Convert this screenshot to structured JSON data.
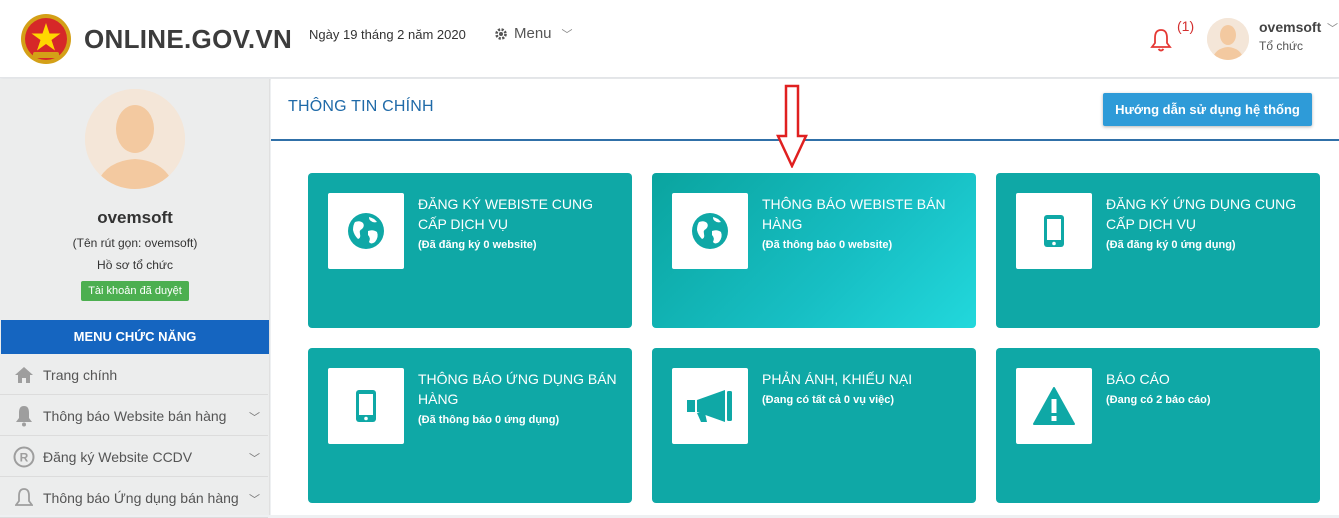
{
  "header": {
    "site_title": "ONLINE.GOV.VN",
    "date": "Ngày 19 tháng 2 năm 2020",
    "menu_label": "Menu",
    "notification_count": "(1)",
    "user_name": "ovemsoft",
    "user_role": "Tổ chức"
  },
  "sidebar": {
    "name": "ovemsoft",
    "short_name": "(Tên rút gọn: ovemsoft)",
    "profile_label": "Hồ sơ tổ chức",
    "account_badge": "Tài khoản đã duyệt",
    "menu_header": "MENU CHỨC NĂNG",
    "items": [
      {
        "label": "Trang chính",
        "icon": "home-icon"
      },
      {
        "label": "Thông báo Website bán hàng",
        "icon": "bell-icon"
      },
      {
        "label": "Đăng ký Website CCDV",
        "icon": "registered-icon"
      },
      {
        "label": "Thông báo Ứng dụng bán hàng",
        "icon": "bell-outline-icon"
      }
    ]
  },
  "main": {
    "title": "THÔNG TIN CHÍNH",
    "guide_button": "Hướng dẫn sử dụng hệ thống",
    "tiles": [
      {
        "title": "ĐĂNG KÝ WEBISTE CUNG CẤP DỊCH VỤ",
        "subtitle": "(Đã đăng ký 0 website)",
        "icon": "globe-icon"
      },
      {
        "title": "THÔNG BÁO WEBISTE BÁN HÀNG",
        "subtitle": "(Đã thông báo 0 website)",
        "icon": "globe-icon"
      },
      {
        "title": "ĐĂNG KÝ ỨNG DỤNG CUNG CẤP DỊCH VỤ",
        "subtitle": "(Đã đăng ký 0 ứng dụng)",
        "icon": "mobile-icon"
      },
      {
        "title": "THÔNG BÁO ỨNG DỤNG BÁN HÀNG",
        "subtitle": "(Đã thông báo 0 ứng dụng)",
        "icon": "mobile-icon"
      },
      {
        "title": "PHẢN ÁNH, KHIẾU NẠI",
        "subtitle": "(Đang có tất cả 0 vụ việc)",
        "icon": "megaphone-icon"
      },
      {
        "title": "BÁO CÁO",
        "subtitle": "(Đang có 2 báo cáo)",
        "icon": "warning-icon"
      }
    ]
  },
  "colors": {
    "tile": "#0fa8a6",
    "menu_header": "#1565c0",
    "title_blue": "#1f6aa8",
    "guide_button": "#2e9bd8",
    "badge_green": "#4caf50",
    "annotation_arrow": "#e02020"
  }
}
